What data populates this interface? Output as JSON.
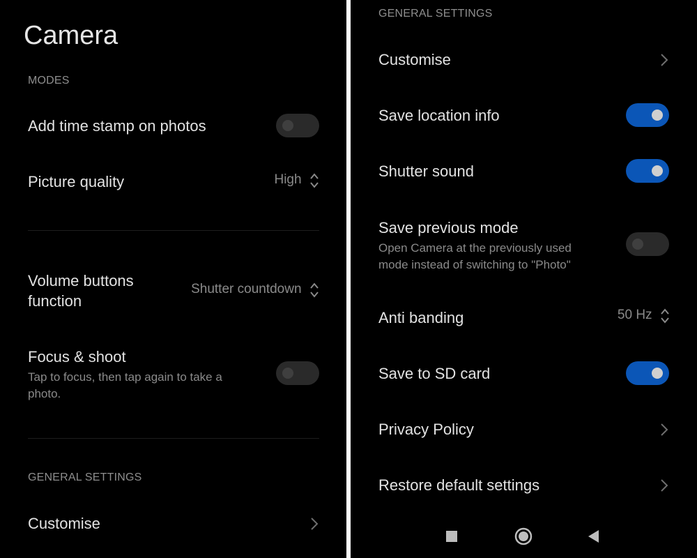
{
  "left": {
    "title": "Camera",
    "modes_header": "MODES",
    "time_stamp": {
      "label": "Add time stamp on photos",
      "enabled": false
    },
    "picture_quality": {
      "label": "Picture quality",
      "value": "High",
      "icon": "updown-chevron-icon"
    },
    "volume_buttons": {
      "label_line1": "Volume buttons",
      "label_line2": "function",
      "value": "Shutter countdown",
      "icon": "updown-chevron-icon"
    },
    "focus_shoot": {
      "label": "Focus & shoot",
      "sub_line1": "Tap to focus, then tap again to take a",
      "sub_line2": "photo.",
      "enabled": false
    },
    "general_header": "GENERAL SETTINGS",
    "customise": {
      "label": "Customise",
      "icon": "chevron-right-icon"
    }
  },
  "right": {
    "general_header": "GENERAL SETTINGS",
    "customise": {
      "label": "Customise",
      "icon": "chevron-right-icon"
    },
    "save_location": {
      "label": "Save location info",
      "enabled": true
    },
    "shutter_sound": {
      "label": "Shutter sound",
      "enabled": true
    },
    "save_previous_mode": {
      "label": "Save previous mode",
      "sub_line1": "Open Camera at the previously used",
      "sub_line2": "mode instead of switching to \"Photo\"",
      "enabled": false
    },
    "anti_banding": {
      "label": "Anti banding",
      "value": "50 Hz",
      "icon": "updown-chevron-icon"
    },
    "save_sd": {
      "label": "Save to SD card",
      "enabled": true
    },
    "privacy": {
      "label": "Privacy Policy",
      "icon": "chevron-right-icon"
    },
    "restore": {
      "label": "Restore default settings",
      "icon": "chevron-right-icon"
    },
    "nav": {
      "icons": [
        "recents-square-icon",
        "home-circle-icon",
        "back-triangle-icon"
      ]
    }
  },
  "colors": {
    "background": "#000000",
    "accent": "#0b56b7",
    "divider_gap": "#ffffff"
  }
}
